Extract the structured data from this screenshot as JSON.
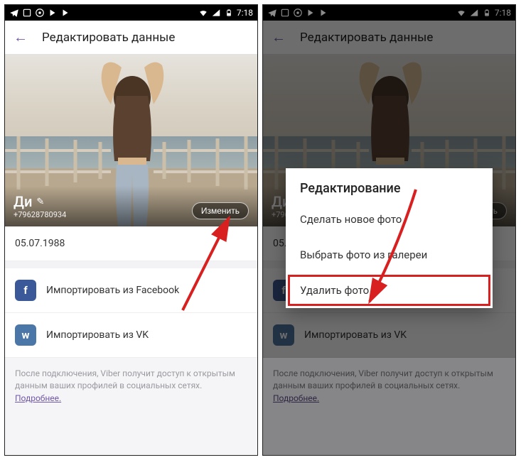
{
  "status": {
    "time": "7:18"
  },
  "header": {
    "title": "Редактировать данные"
  },
  "profile": {
    "name": "Ди",
    "phone": "+79628780934",
    "change_btn": "Изменить"
  },
  "birthday": "05.07.1988",
  "import": {
    "fb": "Импортировать из Facebook",
    "vk": "Импортировать из VK"
  },
  "footer": {
    "text": "После подключения, Viber получит доступ к открытым данным ваших профилей в социальных сетях.",
    "more": "Подробнее."
  },
  "dialog": {
    "title": "Редактирование",
    "opt_new": "Сделать новое фото",
    "opt_gallery": "Выбрать фото из галереи",
    "opt_delete": "Удалить фото"
  }
}
